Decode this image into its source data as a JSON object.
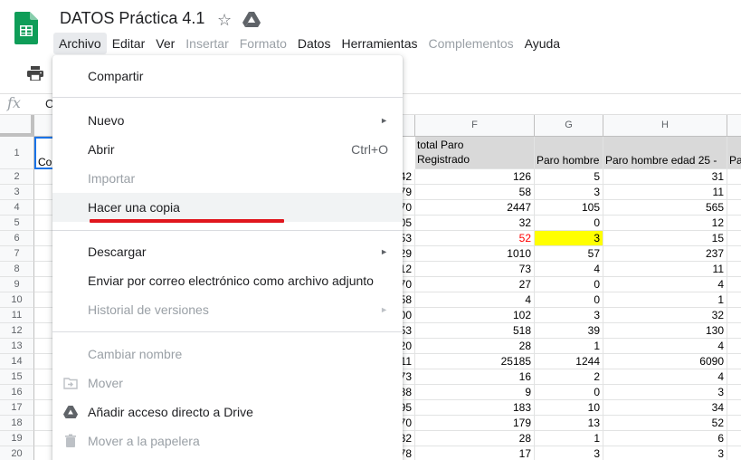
{
  "header": {
    "title": "DATOS Práctica 4.1"
  },
  "menubar": {
    "items": [
      {
        "label": "Archivo",
        "state": "active"
      },
      {
        "label": "Editar",
        "state": "normal"
      },
      {
        "label": "Ver",
        "state": "normal"
      },
      {
        "label": "Insertar",
        "state": "disabled"
      },
      {
        "label": "Formato",
        "state": "disabled"
      },
      {
        "label": "Datos",
        "state": "normal"
      },
      {
        "label": "Herramientas",
        "state": "normal"
      },
      {
        "label": "Complementos",
        "state": "disabled"
      },
      {
        "label": "Ayuda",
        "state": "normal"
      }
    ]
  },
  "formula": {
    "fx": "fx",
    "value": "C"
  },
  "grid": {
    "columns": [
      "F",
      "G",
      "H"
    ],
    "header_cells": {
      "a1": "Co",
      "f": "total Paro\nRegistrado",
      "f1": "total Paro",
      "f2": "Registrado",
      "g": "Paro hombre",
      "h": "Paro hombre edad 25 -",
      "i": "Pa"
    },
    "row_numbers": [
      "1",
      "2",
      "3",
      "4",
      "5",
      "6",
      "7",
      "8",
      "9",
      "10",
      "11",
      "12",
      "13",
      "14",
      "15",
      "16",
      "17",
      "18",
      "19",
      "20"
    ],
    "partial_e": [
      "42",
      "79",
      "70",
      "05",
      "53",
      "29",
      "12",
      "70",
      "58",
      "00",
      "53",
      "20",
      "11",
      "73",
      "38",
      "95",
      "70",
      "32",
      "78"
    ],
    "col_f": [
      "126",
      "58",
      "2447",
      "32",
      "52",
      "1010",
      "73",
      "27",
      "4",
      "102",
      "518",
      "28",
      "25185",
      "16",
      "9",
      "183",
      "179",
      "28",
      "17"
    ],
    "col_g": [
      "5",
      "3",
      "105",
      "0",
      "3",
      "57",
      "4",
      "0",
      "0",
      "3",
      "39",
      "1",
      "1244",
      "2",
      "0",
      "10",
      "13",
      "1",
      "3"
    ],
    "col_h": [
      "31",
      "11",
      "565",
      "12",
      "15",
      "237",
      "11",
      "4",
      "1",
      "32",
      "130",
      "4",
      "6090",
      "4",
      "3",
      "34",
      "52",
      "6",
      "3"
    ]
  },
  "dropdown": {
    "items": [
      {
        "label": "Compartir",
        "state": "normal"
      },
      {
        "label": "Nuevo",
        "state": "normal",
        "submenu": true
      },
      {
        "label": "Abrir",
        "state": "normal",
        "shortcut": "Ctrl+O"
      },
      {
        "label": "Importar",
        "state": "disabled"
      },
      {
        "label": "Hacer una copia",
        "state": "hover"
      },
      {
        "label": "Descargar",
        "state": "normal",
        "submenu": true
      },
      {
        "label": "Enviar por correo electrónico como archivo adjunto",
        "state": "normal"
      },
      {
        "label": "Historial de versiones",
        "state": "disabled",
        "submenu": true
      },
      {
        "label": "Cambiar nombre",
        "state": "disabled"
      },
      {
        "label": "Mover",
        "state": "disabled",
        "icon": "move-folder-icon"
      },
      {
        "label": "Añadir acceso directo a Drive",
        "state": "normal",
        "icon": "drive-shortcut-icon"
      },
      {
        "label": "Mover a la papelera",
        "state": "disabled",
        "icon": "trash-icon"
      }
    ],
    "submenu_arrow": "►"
  },
  "colors": {
    "accent": "#1a73e8",
    "sheets_green": "#0f9d58",
    "highlight_yellow": "#ffff00",
    "underline_red": "#e0161d",
    "red_text": "#ff0000"
  }
}
